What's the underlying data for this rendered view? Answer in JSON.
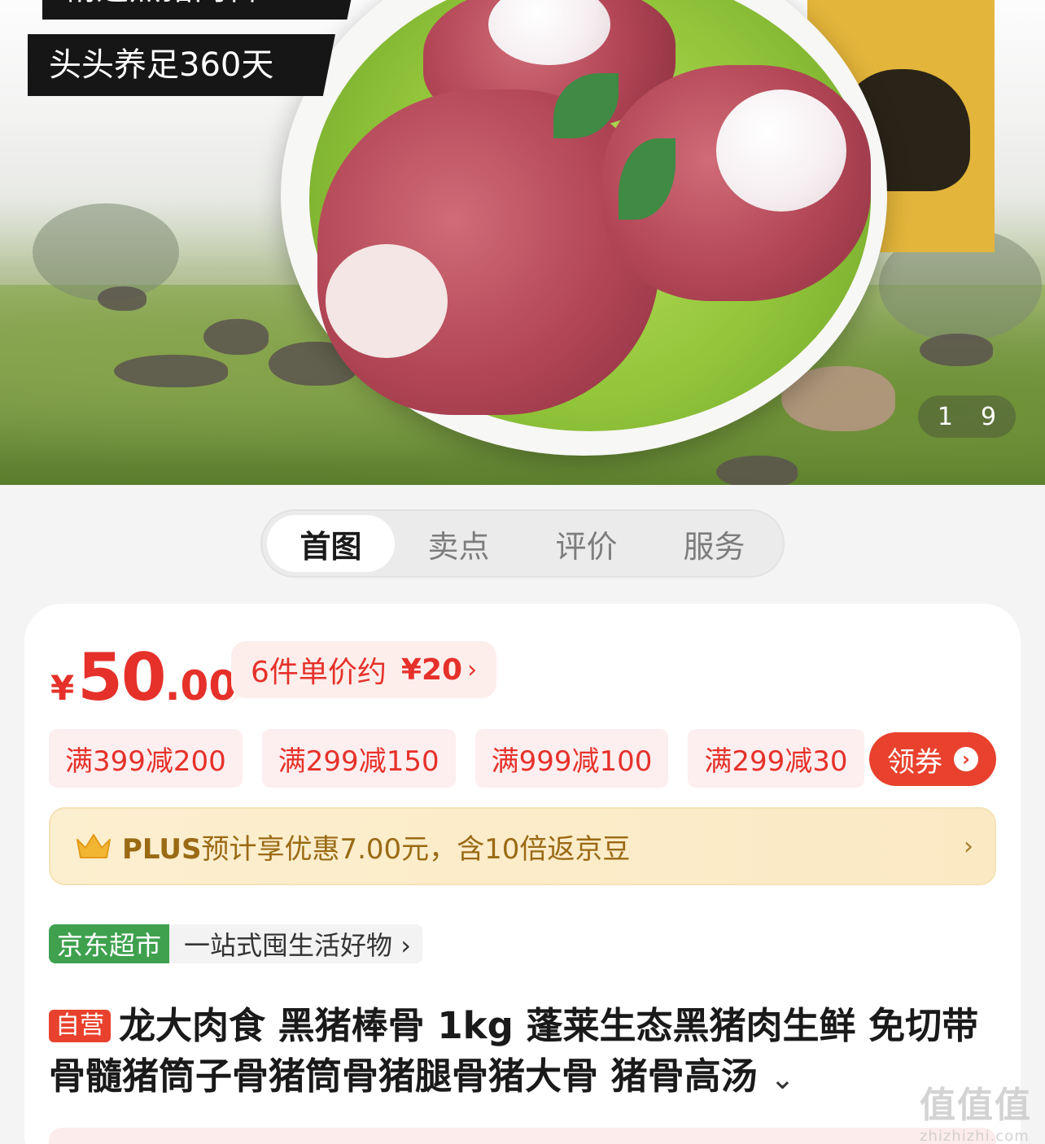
{
  "hero": {
    "tag_top": "精选黑猪肉料",
    "tag_bottom": "头头养足360天",
    "counter_current": "1",
    "counter_total": "9"
  },
  "tabs": [
    {
      "label": "首图",
      "active": true
    },
    {
      "label": "卖点",
      "active": false
    },
    {
      "label": "评价",
      "active": false
    },
    {
      "label": "服务",
      "active": false
    }
  ],
  "price": {
    "currency": "¥",
    "integer": "50",
    "decimal": ".00",
    "unit_prefix": "6件单价约",
    "unit_price": "¥20",
    "unit_chevron": "›"
  },
  "coupons": [
    "满399减200",
    "满299减150",
    "满999减100",
    "满299减30"
  ],
  "get_coupon": {
    "label": "领券",
    "icon": "chevron-right-icon"
  },
  "plus": {
    "brand": "PLUS",
    "text": "预计享优惠7.00元，含10倍返京豆",
    "chevron": "›"
  },
  "market": {
    "badge": "京东超市",
    "slogan": "一站式囤生活好物 ›"
  },
  "product": {
    "self_badge": "自营",
    "title": "龙大肉食 黑猪棒骨 1kg 蓬莱生态黑猪肉生鲜 免切带骨髓猪筒子骨猪筒骨猪腿骨猪大骨 猪骨高汤",
    "expand": "⌄"
  },
  "watermark": {
    "logo": "值值值",
    "url": "zhizhizhi.com"
  },
  "colors": {
    "accent": "#e5312a",
    "plus": "#9a6a14",
    "market_green": "#3fa14e"
  }
}
